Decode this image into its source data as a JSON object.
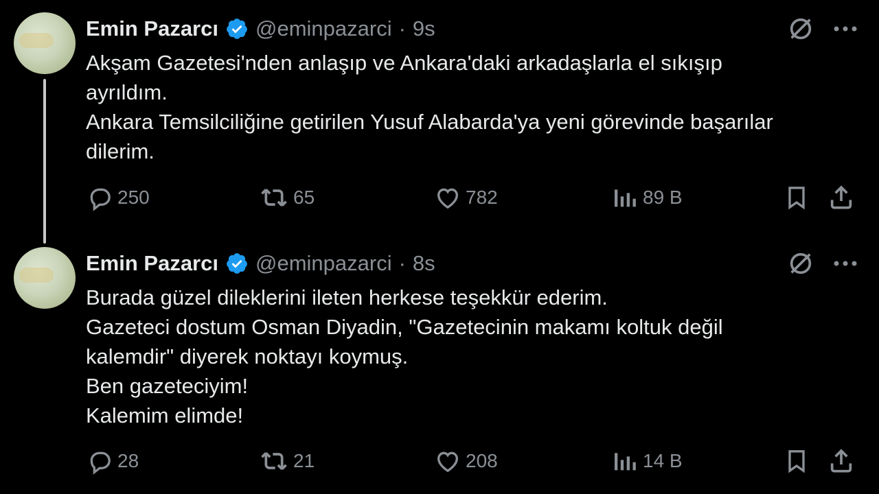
{
  "tweets": [
    {
      "author_name": "Emin Pazarcı",
      "handle": "@eminpazarci",
      "separator": "·",
      "time": "9s",
      "lines": [
        "Akşam Gazetesi'nden anlaşıp ve Ankara'daki arkadaşlarla el sıkışıp",
        "ayrıldım.",
        "Ankara Temsilciliğine getirilen Yusuf Alabarda'ya yeni görevinde başarılar",
        "dilerim."
      ],
      "stats": {
        "replies": "250",
        "retweets": "65",
        "likes": "782",
        "views": "89 B"
      }
    },
    {
      "author_name": "Emin Pazarcı",
      "handle": "@eminpazarci",
      "separator": "·",
      "time": "8s",
      "lines": [
        "Burada güzel dileklerini ileten herkese teşekkür ederim.",
        "Gazeteci dostum Osman Diyadin, \"Gazetecinin makamı koltuk değil",
        "kalemdir\" diyerek noktayı koymuş.",
        "Ben gazeteciyim!",
        "Kalemim elimde!"
      ],
      "stats": {
        "replies": "28",
        "retweets": "21",
        "likes": "208",
        "views": "14 B"
      }
    }
  ],
  "colors": {
    "background": "#000000",
    "text": "#e7e9ea",
    "muted": "#8b9096",
    "verified": "#1d9bf0"
  },
  "icons": [
    "verified-badge-icon",
    "grok-icon",
    "more-icon",
    "reply-icon",
    "retweet-icon",
    "like-icon",
    "views-icon",
    "bookmark-icon",
    "share-icon"
  ]
}
